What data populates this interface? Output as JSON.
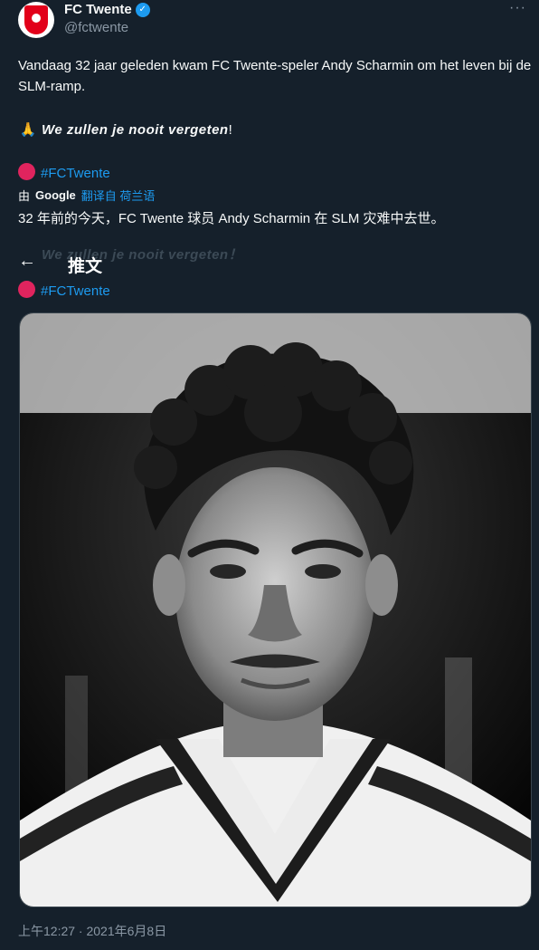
{
  "author": {
    "name": "FC Twente",
    "handle": "@fctwente"
  },
  "tweet": {
    "line1": "Vandaag 32 jaar geleden kwam FC Twente-speler Andy Scharmin om het leven bij de SLM-ramp.",
    "line3_emoji": "🙏",
    "line3_text": "We zullen je nooit vergeten",
    "line3_end": "!",
    "hashtag": "#FCTwente"
  },
  "translation": {
    "by": "由",
    "google": "Google",
    "link": "翻译自 荷兰语",
    "zh_line": "32 年前的今天，FC Twente 球员 Andy Scharmin 在 SLM 灾难中去世。",
    "faded_line": "We zullen je nooit vergeten！"
  },
  "header": {
    "back": "←",
    "title": "推文"
  },
  "meta": {
    "time": "上午12:27 · 2021年6月8日"
  },
  "icons": {
    "more": "more-icon",
    "verified": "verified-badge-icon"
  },
  "colors": {
    "background": "#15202b",
    "accent": "#1d9bf0"
  }
}
